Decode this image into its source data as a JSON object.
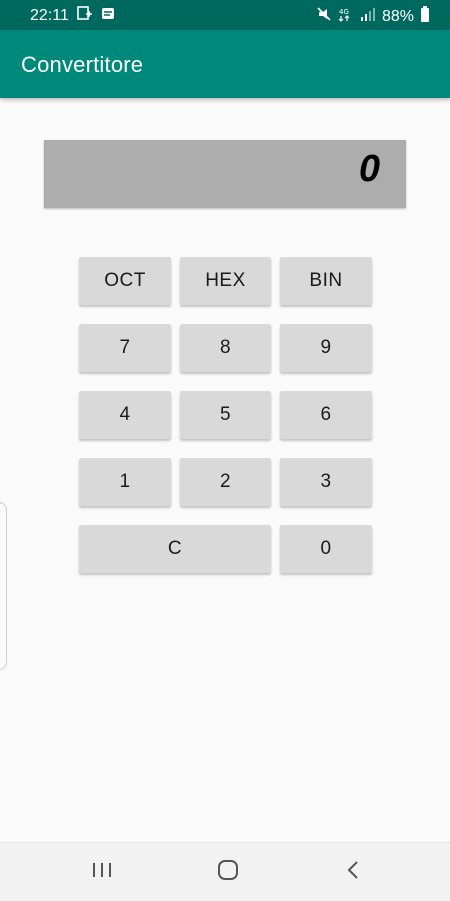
{
  "status_bar": {
    "time": "22:11",
    "battery_percent": "88%",
    "icons": [
      "dnd-off-icon",
      "lte-icon",
      "signal-icon",
      "battery-icon",
      "media-icon",
      "message-icon"
    ]
  },
  "app_bar": {
    "title": "Convertitore",
    "color": "#00897b"
  },
  "display": {
    "value": "0"
  },
  "keypad": {
    "oct": "OCT",
    "hex": "HEX",
    "bin": "BIN",
    "k7": "7",
    "k8": "8",
    "k9": "9",
    "k4": "4",
    "k5": "5",
    "k6": "6",
    "k1": "1",
    "k2": "2",
    "k3": "3",
    "clear": "C",
    "k0": "0"
  },
  "nav_bar": {
    "icons": [
      "recent-apps-icon",
      "home-icon",
      "back-icon"
    ]
  }
}
